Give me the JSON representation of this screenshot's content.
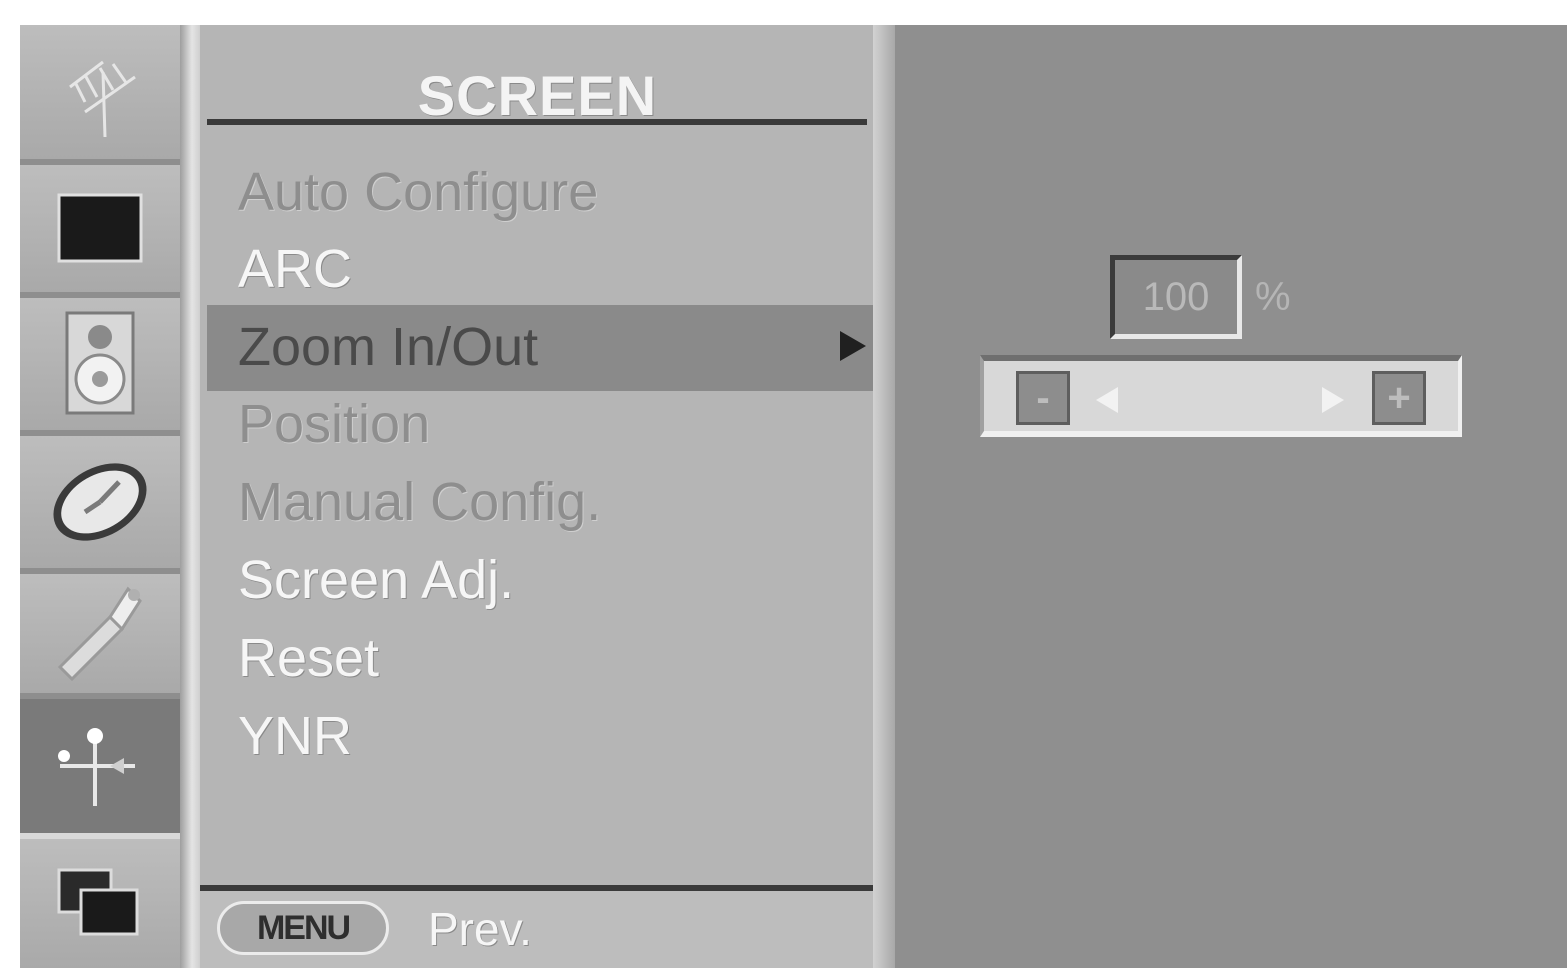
{
  "menu": {
    "title": "SCREEN",
    "items": [
      {
        "label": "Auto Configure",
        "state": "dim"
      },
      {
        "label": "ARC",
        "state": "normal"
      },
      {
        "label": "Zoom In/Out",
        "state": "selected"
      },
      {
        "label": "Position",
        "state": "dim"
      },
      {
        "label": "Manual Config.",
        "state": "dim"
      },
      {
        "label": "Screen Adj.",
        "state": "normal"
      },
      {
        "label": "Reset",
        "state": "normal"
      },
      {
        "label": "YNR",
        "state": "normal"
      }
    ],
    "footer": {
      "menu_button_label": "MENU",
      "prev_label": "Prev."
    }
  },
  "sidebar": {
    "icons": [
      "antenna-icon",
      "picture-icon",
      "speaker-icon",
      "time-icon",
      "option-icon",
      "screen-adjust-icon",
      "pip-icon"
    ],
    "active_icon": "screen-adjust-icon"
  },
  "zoom_control": {
    "value": "100",
    "unit": "%",
    "min_box_label": "-",
    "max_box_label": "+"
  },
  "colors": {
    "panel_bg": "#b5b5b5",
    "highlight_bg": "#8a8a8a",
    "right_bg": "#8f8f8f"
  }
}
